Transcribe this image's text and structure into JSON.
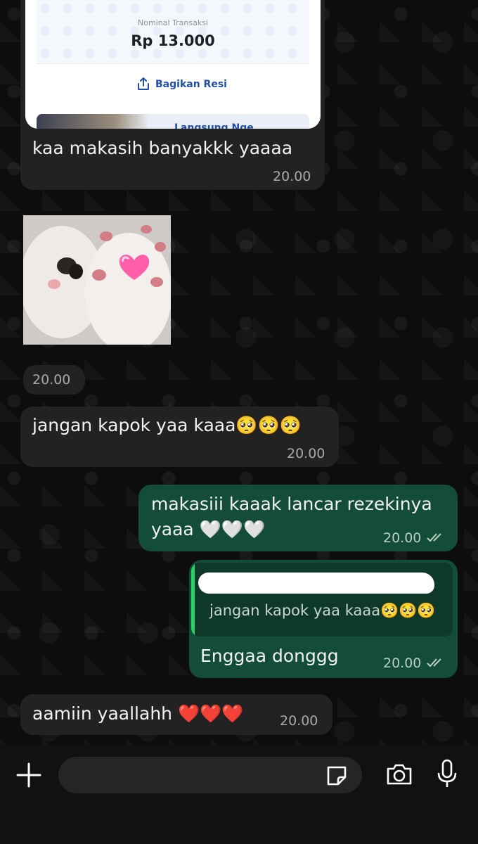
{
  "receipt": {
    "label": "Nominal Transaksi",
    "amount": "Rp 13.000",
    "share_label": "Bagikan Resi",
    "promo_text": "Langsung Nge..."
  },
  "messages": [
    {
      "text": "kaa makasih banyakkk yaaaa",
      "time": "20.00"
    },
    {
      "time": "20.00"
    },
    {
      "text": "jangan kapok yaa kaaa🥺🥺🥺",
      "time": "20.00"
    },
    {
      "line1": "makasiii kaaak lancar rezekinya",
      "line2": "yaaa 🤍🤍🤍",
      "time": "20.00"
    },
    {
      "quote_text": "jangan kapok yaa kaaa🥺🥺🥺",
      "text": "Enggaa donggg",
      "time": "20.00"
    },
    {
      "text": "aamiin yaallahh ❤️❤️❤️",
      "time": "20.00"
    }
  ],
  "icons": {
    "plus": "plus-icon",
    "sticker": "sticker-icon",
    "camera": "camera-icon",
    "mic": "microphone-icon",
    "read_receipt": "double-check-icon"
  },
  "colors": {
    "incoming_bubble": "#222222",
    "outgoing_bubble": "#134d37",
    "quote_accent": "#25d366"
  }
}
